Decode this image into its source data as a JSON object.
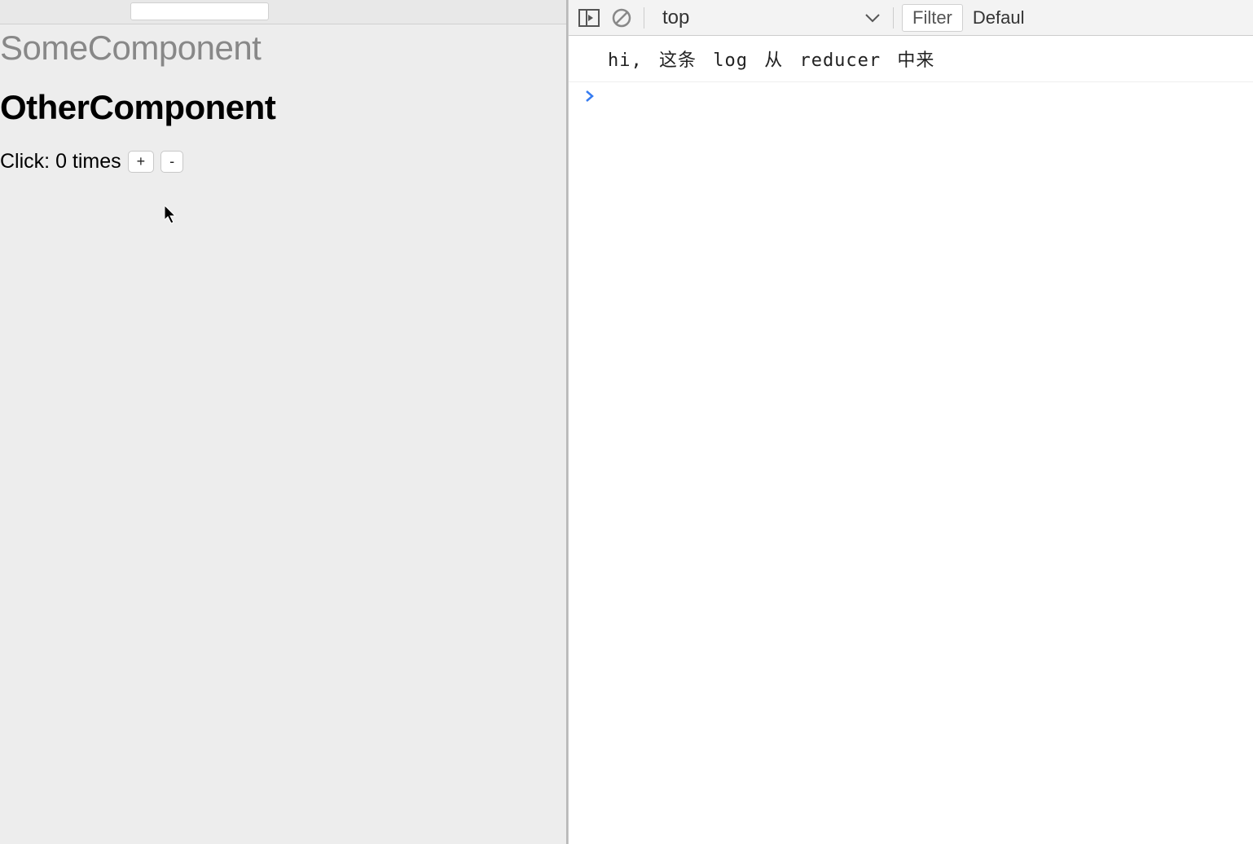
{
  "page": {
    "some_component_title": "SomeComponent",
    "other_component_title": "OtherComponent",
    "click_label_prefix": "Click: ",
    "click_count": "0",
    "click_label_suffix": " times",
    "plus_btn": "+",
    "minus_btn": "-"
  },
  "devtools": {
    "context_selected": "top",
    "filter_label": "Filter",
    "level_label": "Defaul",
    "console_logs": [
      "hi, 这条 log 从 reducer 中来"
    ],
    "prompt": "›"
  },
  "icons": {
    "toggle_drawer": "toggle-drawer-icon",
    "clear_console": "clear-console-icon",
    "chevron_down": "chevron-down-icon"
  }
}
